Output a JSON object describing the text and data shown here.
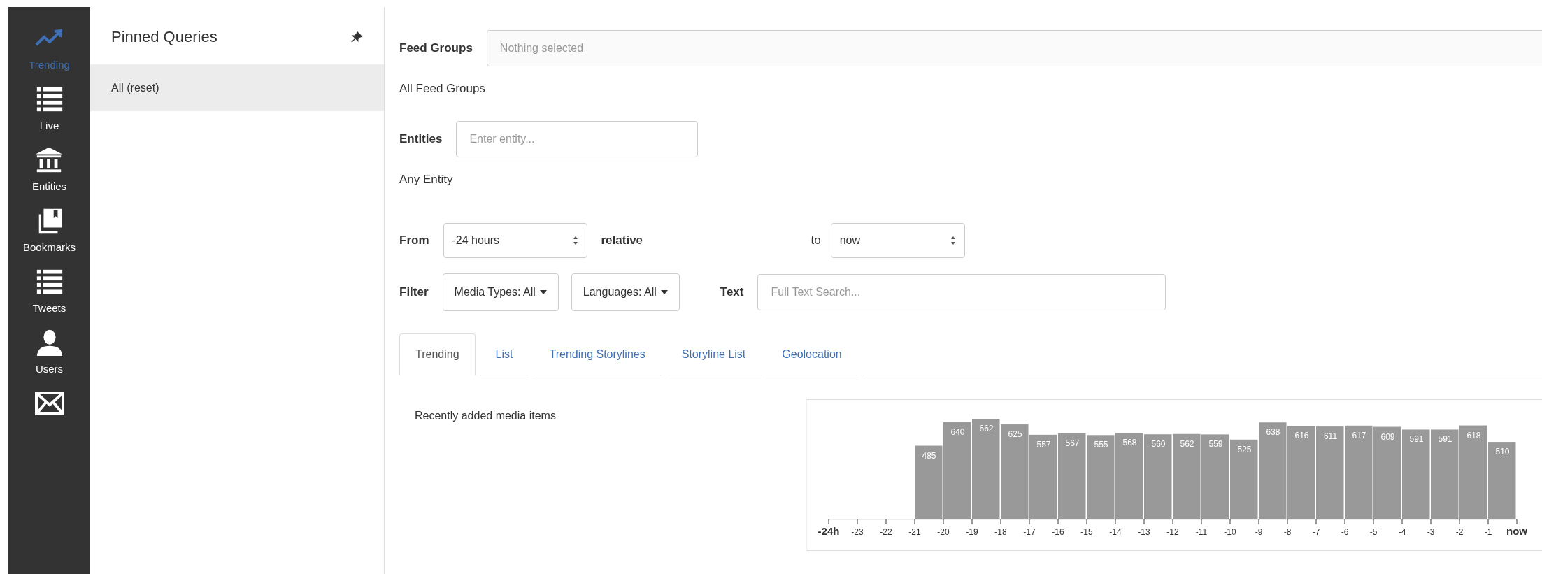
{
  "nav": [
    {
      "label": "Trending",
      "selected": true
    },
    {
      "label": "Live",
      "selected": false
    },
    {
      "label": "Entities",
      "selected": false
    },
    {
      "label": "Bookmarks",
      "selected": false
    },
    {
      "label": "Tweets",
      "selected": false
    },
    {
      "label": "Users",
      "selected": false
    },
    {
      "selected": false
    }
  ],
  "pinned": {
    "title": "Pinned Queries",
    "items": [
      {
        "label": "All (reset)",
        "selected": true
      }
    ]
  },
  "feed_groups": {
    "label": "Feed Groups",
    "placeholder": "Nothing selected",
    "summary": "All Feed Groups"
  },
  "entities": {
    "label": "Entities",
    "placeholder": "Enter entity...",
    "summary": "Any Entity"
  },
  "time": {
    "from_label": "From",
    "from_value": "-24 hours",
    "relative_label": "relative",
    "to_label": "to",
    "to_value": "now"
  },
  "filter": {
    "label": "Filter",
    "dropdowns": [
      "Media Types: All",
      "Languages: All"
    ],
    "text_label": "Text",
    "text_placeholder": "Full Text Search..."
  },
  "tabs": [
    {
      "label": "Trending",
      "selected": true
    },
    {
      "label": "List",
      "selected": false
    },
    {
      "label": "Trending Storylines",
      "selected": false
    },
    {
      "label": "Storyline List",
      "selected": false
    },
    {
      "label": "Geolocation",
      "selected": false
    }
  ],
  "panel": {
    "caption": "Recently added media items",
    "chart_data": {
      "type": "bar",
      "x": [
        -20.5,
        -19.5,
        -18.5,
        -17.5,
        -16.5,
        -15.5,
        -14.5,
        -13.5,
        -12.5,
        -11.5,
        -10.5,
        -9.5,
        -8.5,
        -7.5,
        -6.5,
        -5.5,
        -4.5,
        -3.5,
        -2.5,
        -1.5,
        -0.5
      ],
      "xlim": [
        -24,
        0
      ],
      "values": [
        485,
        640,
        662,
        625,
        557,
        567,
        555,
        568,
        560,
        562,
        559,
        525,
        638,
        616,
        611,
        617,
        609,
        591,
        591,
        618,
        510
      ],
      "xticks": [
        {
          "value": -24,
          "label": "-24h"
        },
        -23,
        -22,
        -21,
        -20,
        -19,
        -18,
        -17,
        -16,
        -15,
        -14,
        -13,
        -12,
        -11,
        -10,
        -9,
        -8,
        -7,
        -6,
        -5,
        -4,
        -3,
        -2,
        -1,
        {
          "value": 0,
          "label": "now"
        }
      ],
      "data_labels": true
    }
  }
}
